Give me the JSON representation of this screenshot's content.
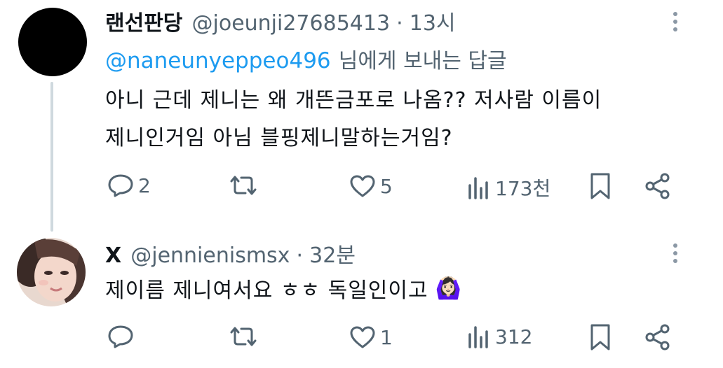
{
  "tweet1": {
    "display_name": "랜선판당",
    "handle": "@joeunji27685413",
    "separator": "·",
    "time": "13시",
    "reply_to_handle": "@naneunyeppeo496",
    "reply_to_suffix": "님에게 보내는 답글",
    "text_line1": "아니 근데 제니는 왜 개뜬금포로 나옴?? 저사람 이름이",
    "text_line2": "제니인거임 아님 블핑제니말하는거임?",
    "actions": {
      "replies": "2",
      "retweets": "",
      "likes": "5",
      "views": "173천"
    }
  },
  "tweet2": {
    "display_name": "X",
    "handle": "@jennienismsx",
    "separator": "·",
    "time": "32분",
    "text": "제이름 제니여서요 ㅎㅎ 독일인이고",
    "emoji": "🙆🏻‍♀️",
    "actions": {
      "replies": "",
      "retweets": "",
      "likes": "1",
      "views": "312"
    }
  },
  "icons": {
    "reply": "reply-icon",
    "retweet": "retweet-icon",
    "like": "heart-icon",
    "views": "views-icon",
    "bookmark": "bookmark-icon",
    "share": "share-icon",
    "more": "more-icon"
  },
  "colors": {
    "link": "#1d9bf0",
    "muted": "#536471",
    "thread_line": "#cfd9de",
    "text": "#0f1419"
  }
}
